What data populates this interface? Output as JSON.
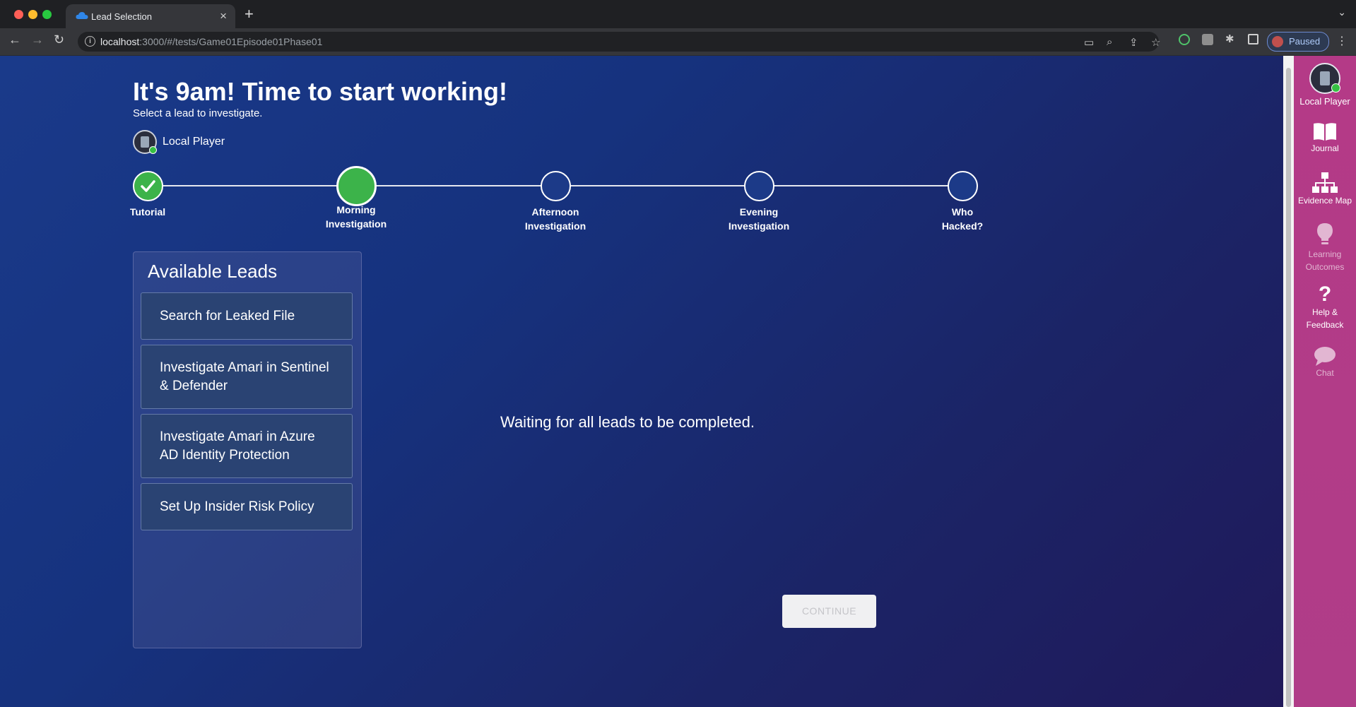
{
  "browser": {
    "tab_title": "Lead Selection",
    "url_host": "localhost",
    "url_rest": ":3000/#/tests/Game01Episode01Phase01",
    "profile_status": "Paused"
  },
  "header": {
    "title": "It's 9am! Time to start working!",
    "subtitle": "Select a lead to investigate.",
    "player_name": "Local Player"
  },
  "progress": {
    "steps": [
      {
        "label": "Tutorial",
        "state": "complete"
      },
      {
        "label": "Morning\nInvestigation",
        "state": "current"
      },
      {
        "label": "Afternoon\nInvestigation",
        "state": "upcoming"
      },
      {
        "label": "Evening\nInvestigation",
        "state": "upcoming"
      },
      {
        "label": "Who\nHacked?",
        "state": "upcoming"
      }
    ]
  },
  "leads": {
    "title": "Available Leads",
    "items": [
      "Search for Leaked File",
      "Investigate Amari in Sentinel & Defender",
      "Investigate Amari in Azure AD Identity Protection",
      "Set Up Insider Risk Policy"
    ]
  },
  "main": {
    "waiting_text": "Waiting for all leads to be completed.",
    "continue_label": "CONTINUE"
  },
  "sidebar": {
    "player_label": "Local Player",
    "items": [
      {
        "label": "Journal",
        "icon": "book-icon"
      },
      {
        "label": "Evidence Map",
        "icon": "org-chart-icon"
      },
      {
        "label": "Learning Outcomes",
        "icon": "lightbulb-icon"
      },
      {
        "label": "Help & Feedback",
        "icon": "question-icon"
      },
      {
        "label": "Chat",
        "icon": "chat-bubble-icon"
      }
    ]
  },
  "colors": {
    "complete": "#3cb34a",
    "sidebar": "#b23b87",
    "page_bg": "#16327e"
  }
}
